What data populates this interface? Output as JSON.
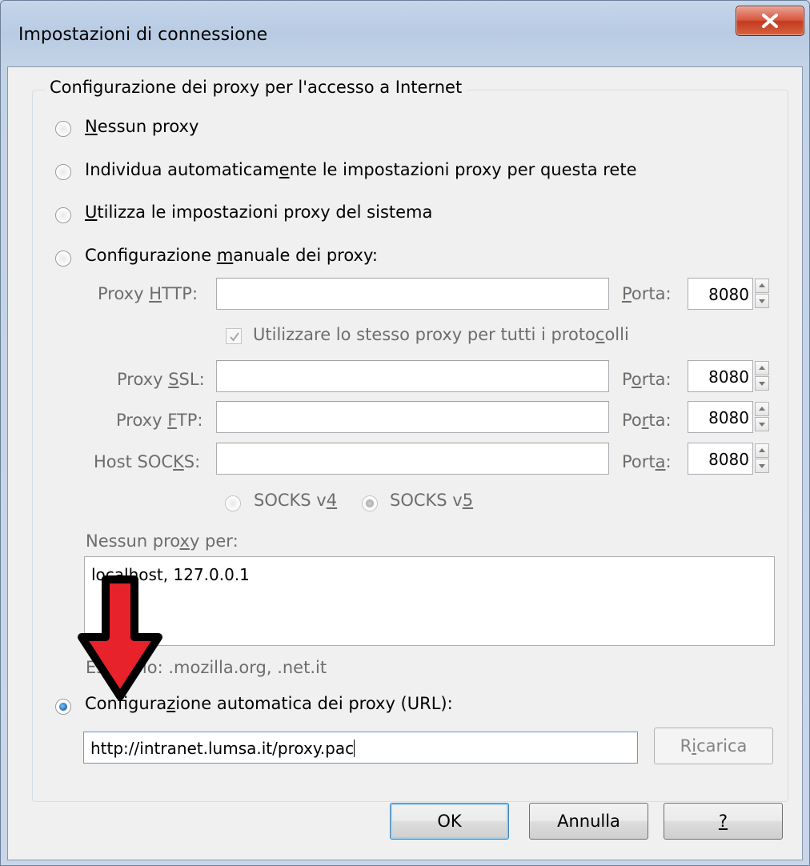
{
  "window": {
    "title": "Impostazioni di connessione"
  },
  "group": {
    "legend": "Configurazione dei proxy per l'accesso a Internet"
  },
  "options": {
    "no_proxy": {
      "pre": "",
      "key": "N",
      "post": "essun proxy",
      "selected": false
    },
    "auto_detect": {
      "pre": "Individua automaticam",
      "key": "e",
      "post": "nte le impostazioni proxy per questa rete",
      "selected": false
    },
    "system": {
      "pre": "",
      "key": "U",
      "post": "tilizza le impostazioni proxy del sistema",
      "selected": false
    },
    "manual": {
      "pre": "Configurazione ",
      "key": "m",
      "post": "anuale dei proxy:",
      "selected": false
    },
    "auto_url": {
      "pre": "Configura",
      "key": "z",
      "post": "ione automatica dei proxy (URL):",
      "selected": true
    }
  },
  "manual": {
    "http": {
      "label_pre": "Proxy ",
      "label_key": "H",
      "label_post": "TTP:",
      "value": "",
      "port_pre": "",
      "port_key": "P",
      "port_post": "orta:",
      "port": "8080"
    },
    "same_proxy": {
      "pre": "Utilizzare lo stesso proxy per tutti i proto",
      "key": "c",
      "post": "olli",
      "checked": true
    },
    "ssl": {
      "label_pre": "Proxy ",
      "label_key": "S",
      "label_post": "SL:",
      "value": "",
      "port_pre": "P",
      "port_key": "o",
      "port_post": "rta:",
      "port": "8080"
    },
    "ftp": {
      "label_pre": "Proxy ",
      "label_key": "F",
      "label_post": "TP:",
      "value": "",
      "port_pre": "Po",
      "port_key": "r",
      "port_post": "ta:",
      "port": "8080"
    },
    "socks": {
      "label_pre": "Host SOC",
      "label_key": "K",
      "label_post": "S:",
      "value": "",
      "port_pre": "Port",
      "port_key": "a",
      "port_post": ":",
      "port": "8080"
    },
    "socks_v4": {
      "pre": "SOCKS v",
      "key": "4",
      "selected": false
    },
    "socks_v5": {
      "pre": "SOCKS v",
      "key": "5",
      "selected": true
    },
    "no_proxy_for": {
      "pre": "Nessun pro",
      "key": "x",
      "post": "y per:",
      "value": "localhost, 127.0.0.1"
    },
    "example": "Esempio: .mozilla.org, .net.it"
  },
  "auto_url": {
    "value": "http://intranet.lumsa.it/proxy.pac",
    "reload_pre": "R",
    "reload_key": "i",
    "reload_post": "carica"
  },
  "buttons": {
    "ok": "OK",
    "cancel": "Annulla",
    "help": "?"
  },
  "colors": {
    "arrow_fill": "#e8222a",
    "arrow_outline": "#000000",
    "radio_selected": "#1a68b2"
  },
  "annotations": {
    "arrow": "red-down-arrow-icon"
  }
}
